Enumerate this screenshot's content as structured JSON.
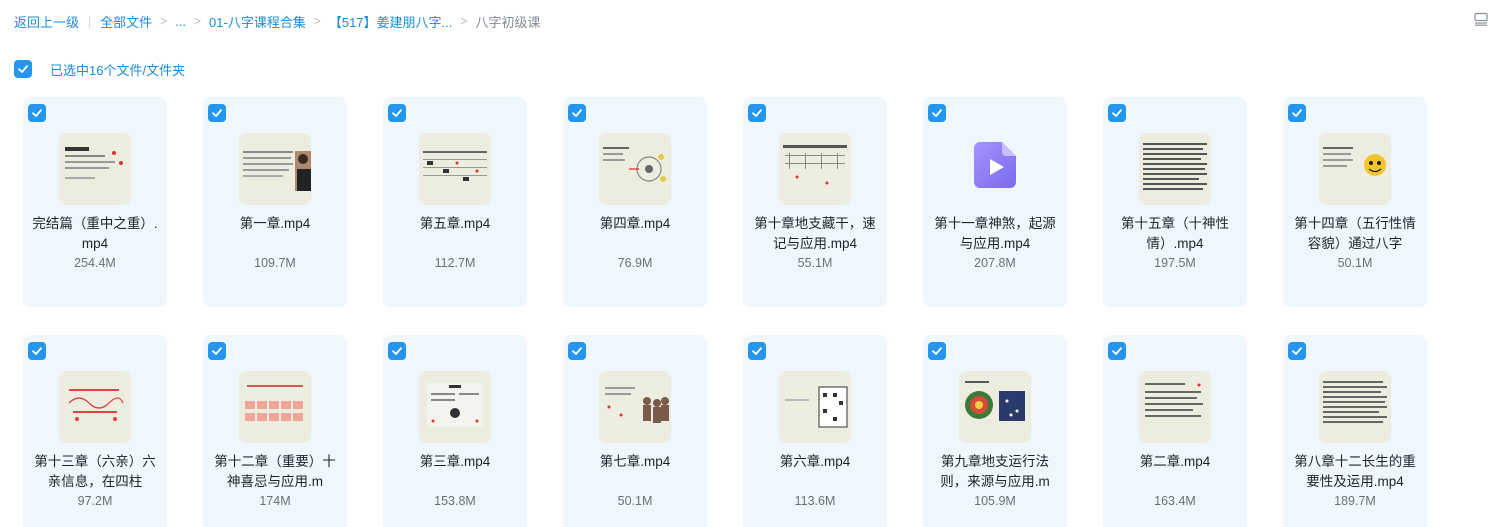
{
  "breadcrumb": {
    "back": "返回上一级",
    "root": "全部文件",
    "ellipsis": "...",
    "folder1": "01-八字课程合集",
    "folder2": "【517】姜建朋八字...",
    "current": "八字初级课"
  },
  "toolbar": {
    "view_toggle_icon": "list-view-icon"
  },
  "selection": {
    "text": "已选中16个文件/文件夹",
    "checked": true
  },
  "colors": {
    "accent": "#2496ee",
    "link": "#1a8cd8",
    "card_bg": "#eff7fd",
    "video_icon": "#8f7df2"
  },
  "files": [
    {
      "name": "完结篇（重中之重）.mp4",
      "size": "254.4M",
      "thumb": "doc",
      "checked": true
    },
    {
      "name": "第一章.mp4",
      "size": "109.7M",
      "thumb": "person",
      "checked": true
    },
    {
      "name": "第五章.mp4",
      "size": "112.7M",
      "thumb": "table",
      "checked": true
    },
    {
      "name": "第四章.mp4",
      "size": "76.9M",
      "thumb": "wheel",
      "checked": true
    },
    {
      "name": "第十章地支藏干，速记与应用.mp4",
      "size": "55.1M",
      "thumb": "chart",
      "checked": true
    },
    {
      "name": "第十一章神煞，起源与应用.mp4",
      "size": "207.8M",
      "thumb": "video-icon",
      "checked": true
    },
    {
      "name": "第十五章（十神性情）.mp4",
      "size": "197.5M",
      "thumb": "dense",
      "checked": true
    },
    {
      "name": "第十四章（五行性情容貌）通过八字",
      "size": "50.1M",
      "thumb": "cartoon",
      "checked": true
    },
    {
      "name": "第十三章（六亲）六亲信息，在四柱",
      "size": "97.2M",
      "thumb": "red",
      "checked": true
    },
    {
      "name": "第十二章（重要）十神喜忌与应用.m",
      "size": "174M",
      "thumb": "boxes",
      "checked": true
    },
    {
      "name": "第三章.mp4",
      "size": "153.8M",
      "thumb": "dark",
      "checked": true
    },
    {
      "name": "第七章.mp4",
      "size": "50.1M",
      "thumb": "figures",
      "checked": true
    },
    {
      "name": "第六章.mp4",
      "size": "113.6M",
      "thumb": "bagua",
      "checked": true
    },
    {
      "name": "第九章地支运行法则，来源与应用.m",
      "size": "105.9M",
      "thumb": "circles",
      "checked": true
    },
    {
      "name": "第二章.mp4",
      "size": "163.4M",
      "thumb": "text",
      "checked": true
    },
    {
      "name": "第八章十二长生的重要性及运用.mp4",
      "size": "189.7M",
      "thumb": "dense2",
      "checked": true
    }
  ]
}
